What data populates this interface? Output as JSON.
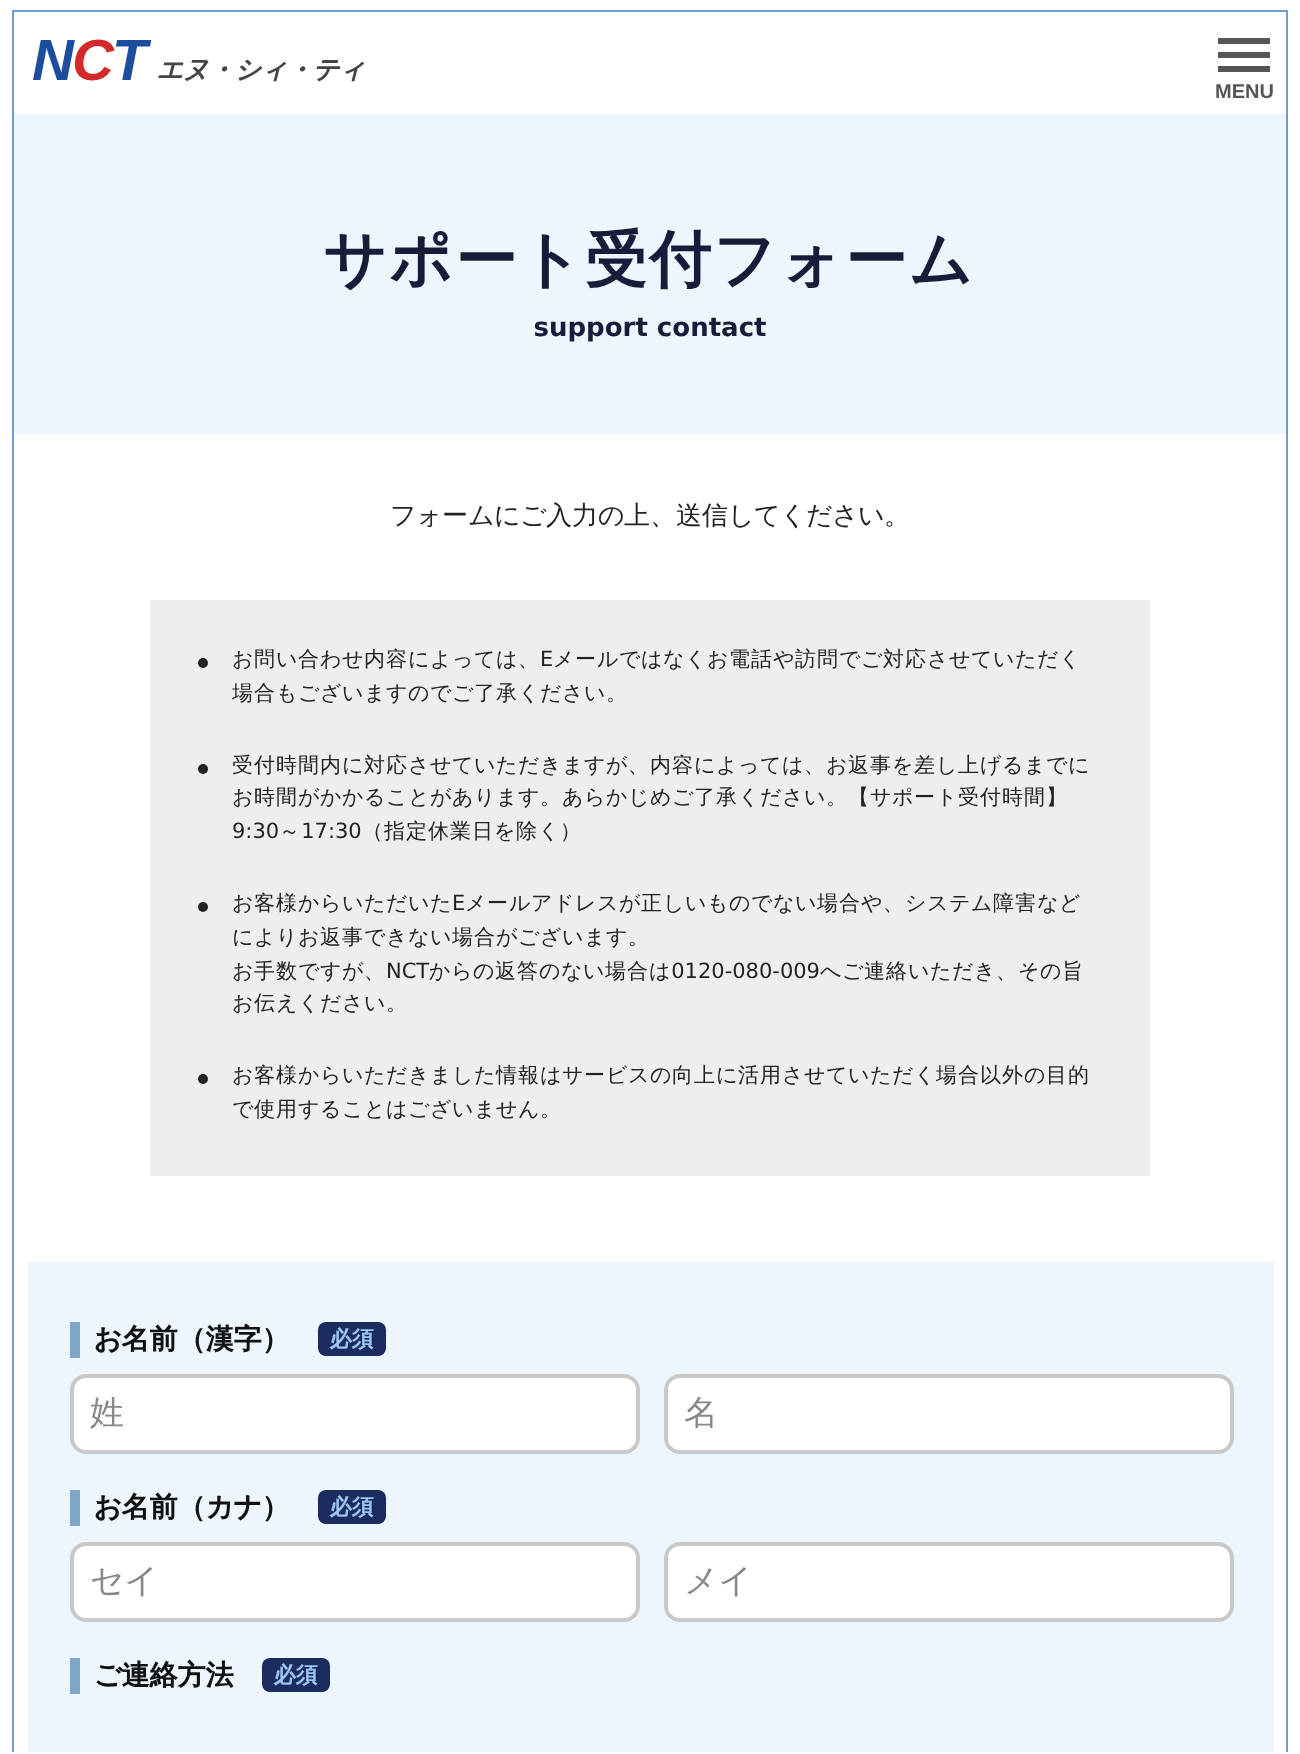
{
  "header": {
    "logo_letters": [
      {
        "text": "N",
        "color": "#1d4d9e"
      },
      {
        "text": "C",
        "color": "#d3292b"
      },
      {
        "text": "T",
        "color": "#1d4d9e"
      }
    ],
    "logo_kana": "エヌ・シィ・ティ",
    "menu_label": "MENU"
  },
  "hero": {
    "title": "サポート受付フォーム",
    "subtitle": "support contact"
  },
  "intro": "フォームにご入力の上、送信してください。",
  "notes": [
    {
      "paragraphs": [
        "お問い合わせ内容によっては、Eメールではなくお電話や訪問でご対応させていただく場合もございますのでご了承ください。"
      ]
    },
    {
      "paragraphs": [
        "受付時間内に対応させていただきますが、内容によっては、お返事を差し上げるまでにお時間がかかることがあります。あらかじめご了承ください。【サポート受付時間】9:30～17:30（指定休業日を除く）"
      ]
    },
    {
      "paragraphs": [
        "お客様からいただいたEメールアドレスが正しいものでない場合や、システム障害などによりお返事できない場合がございます。",
        "お手数ですが、NCTからの返答のない場合は0120-080-009へご連絡いただき、その旨お伝えください。"
      ]
    },
    {
      "paragraphs": [
        "お客様からいただきました情報はサービスの向上に活用させていただく場合以外の目的で使用することはございません。"
      ]
    }
  ],
  "form": {
    "fields": [
      {
        "label": "お名前（漢字）",
        "required": true,
        "badge": "必須",
        "inputs": [
          {
            "placeholder": "姓"
          },
          {
            "placeholder": "名"
          }
        ]
      },
      {
        "label": "お名前（カナ）",
        "required": true,
        "badge": "必須",
        "inputs": [
          {
            "placeholder": "セイ"
          },
          {
            "placeholder": "メイ"
          }
        ]
      },
      {
        "label": "ご連絡方法",
        "required": true,
        "badge": "必須"
      }
    ]
  }
}
